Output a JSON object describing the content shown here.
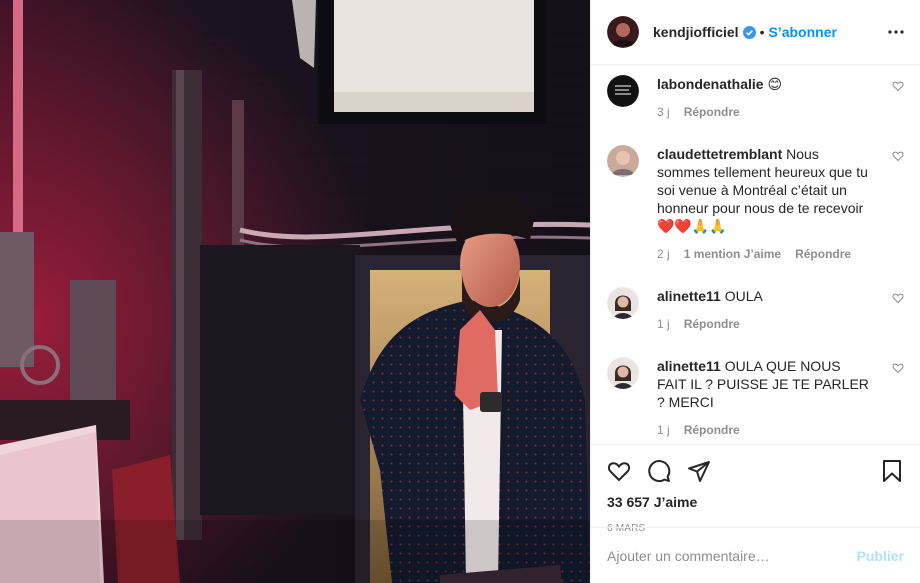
{
  "post": {
    "author": "kendjiofficiel",
    "verified": true,
    "follow_label": "S’abonner",
    "separator": "•",
    "more_icon": "more-horizontal-icon"
  },
  "comments": [
    {
      "username": "labondenathalie",
      "text": "😊",
      "time": "3 j",
      "likes_label": "",
      "reply_label": "Répondre"
    },
    {
      "username": "claudettetremblant",
      "text": "Nous sommes tellement heureux que tu soi venue à Montréal c’était un honneur pour nous de te recevoir ❤️❤️🙏🙏",
      "time": "2 j",
      "likes_label": "1 mention J’aime",
      "reply_label": "Répondre"
    },
    {
      "username": "alinette11",
      "text": "OULA",
      "time": "1 j",
      "likes_label": "",
      "reply_label": "Répondre"
    },
    {
      "username": "alinette11",
      "text": "OULA QUE NOUS FAIT IL ? PUISSE JE TE PARLER ? MERCI",
      "time": "1 j",
      "likes_label": "",
      "reply_label": "Répondre"
    }
  ],
  "stats": {
    "likes": "33 657 J’aime",
    "date": "6 MARS"
  },
  "composer": {
    "placeholder": "Ajouter un commentaire…",
    "publish_label": "Publier"
  },
  "colors": {
    "accent": "#0095f6",
    "publish_disabled": "#b2dffc",
    "muted": "#8e8e8e"
  }
}
